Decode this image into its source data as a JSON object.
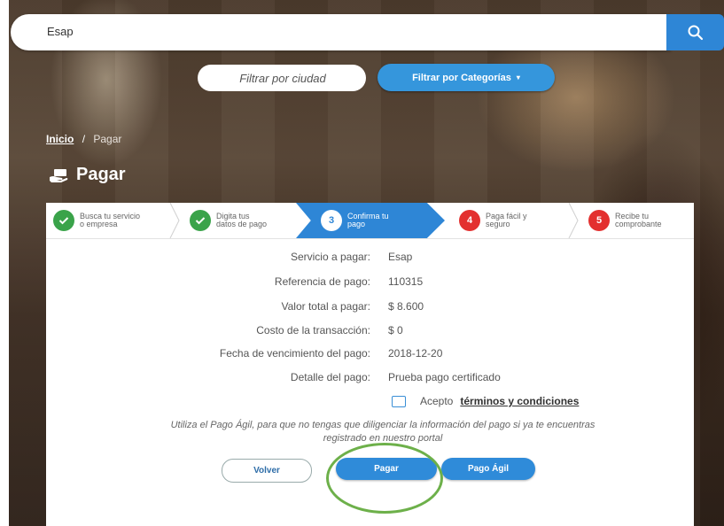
{
  "search": {
    "value": "Esap"
  },
  "filters": {
    "city_placeholder": "Filtrar por ciudad",
    "category_label": "Filtrar por Categorías"
  },
  "breadcrumb": {
    "home": "Inicio",
    "separator": "/",
    "current": "Pagar"
  },
  "page_title": "Pagar",
  "steps": [
    {
      "label_line1": "Busca tu servicio",
      "label_line2": "o empresa",
      "state": "done",
      "number": ""
    },
    {
      "label_line1": "Digita tus",
      "label_line2": "datos de pago",
      "state": "done",
      "number": ""
    },
    {
      "label_line1": "Confirma tu",
      "label_line2": "pago",
      "state": "active",
      "number": "3"
    },
    {
      "label_line1": "Paga fácil y",
      "label_line2": "seguro",
      "state": "todo",
      "number": "4"
    },
    {
      "label_line1": "Recibe tu",
      "label_line2": "comprobante",
      "state": "todo",
      "number": "5"
    }
  ],
  "summary": [
    {
      "label": "Servicio a pagar:",
      "value": "Esap"
    },
    {
      "label": "Referencia de pago:",
      "value": "110315"
    },
    {
      "label": "Valor total a pagar:",
      "value": "$ 8.600"
    },
    {
      "label": "Costo de la transacción:",
      "value": "$ 0"
    },
    {
      "label": "Fecha de vencimiento del pago:",
      "value": "2018-12-20"
    },
    {
      "label": "Detalle del pago:",
      "value": "Prueba pago certificado"
    }
  ],
  "terms": {
    "prefix": "Acepto",
    "link": "términos y condiciones"
  },
  "note": "Utiliza el Pago Ágil, para que no tengas que diligenciar la información del pago si ya te encuentras registrado en nuestro portal",
  "buttons": {
    "back": "Volver",
    "pay": "Pagar",
    "agile": "Pago Ágil"
  },
  "colors": {
    "primary": "#2e86d6",
    "done": "#3aa34a",
    "todo": "#e3302f",
    "highlight": "#6db04a"
  }
}
